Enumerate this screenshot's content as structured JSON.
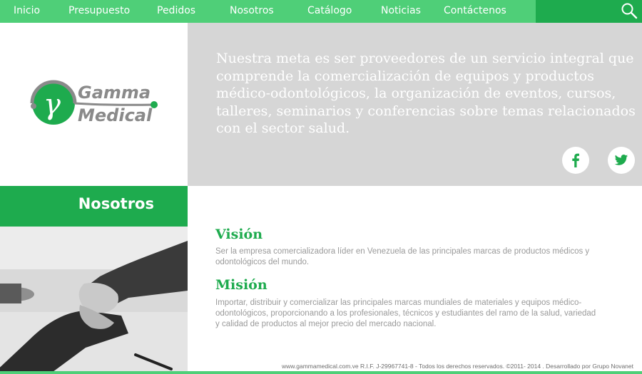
{
  "nav": {
    "items": [
      {
        "label": "Inicio"
      },
      {
        "label": "Presupuesto"
      },
      {
        "label": "Pedidos"
      },
      {
        "label": "Nosotros"
      },
      {
        "label": "Catálogo"
      },
      {
        "label": "Noticias"
      },
      {
        "label": "Contáctenos"
      }
    ],
    "search_icon": "search-icon"
  },
  "logo": {
    "line1": "Gamma",
    "line2": "Medical",
    "symbol": "γ"
  },
  "mission": {
    "text": "Nuestra meta es ser proveedores de un servicio integral que comprende la comercialización de equipos y productos médico-odontológicos, la organización de eventos, cursos, talleres, seminarios y conferencias sobre temas relacionados con el sector salud.",
    "social": [
      {
        "icon": "facebook-icon"
      },
      {
        "icon": "twitter-icon"
      }
    ]
  },
  "section": {
    "title": "Nosotros"
  },
  "content": {
    "vision_heading": "Visión",
    "vision_text": "Ser la empresa comercializadora líder en Venezuela de las principales marcas de productos médicos y odontológicos del mundo.",
    "mision_heading": "Misión",
    "mision_text": "Importar, distribuir y comercializar las principales marcas mundiales de materiales y equipos médico-odontológicos, proporcionando a los profesionales, técnicos y estudiantes del ramo de la salud, variedad y calidad de productos al mejor precio del mercado nacional."
  },
  "footer": {
    "text": "www.gammamedical.com.ve R.I.F. J-29967741-8 - Todos los derechos reservados. ©2011- 2014 . Desarrollado por  Grupo Novanet"
  },
  "colors": {
    "nav_green": "#4fcf78",
    "dark_green": "#1eab4e",
    "banner_grey": "#d6d6d6",
    "body_text": "#9a9a9a"
  }
}
